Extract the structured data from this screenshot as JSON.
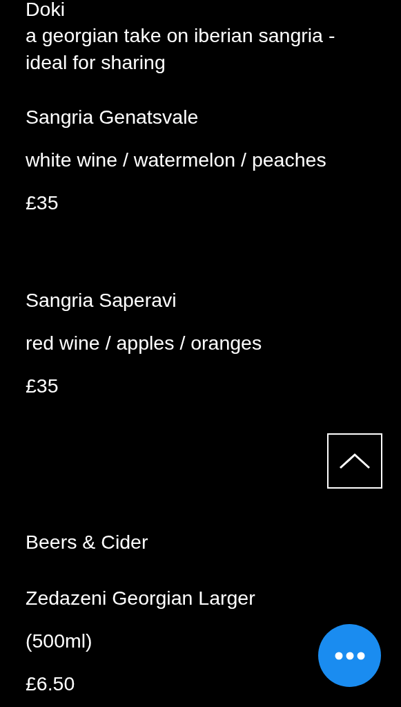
{
  "sections": [
    {
      "title": "Doki",
      "description": "a georgian take on iberian sangria - ideal for sharing",
      "items": [
        {
          "name": "Sangria Genatsvale",
          "description": "white wine / watermelon / peaches",
          "price": "£35"
        },
        {
          "name": "Sangria Saperavi",
          "description": "red wine / apples / oranges",
          "price": "£35"
        }
      ]
    },
    {
      "title": "Beers & Cider",
      "items": [
        {
          "name": "Zedazeni Georgian Larger",
          "description": "(500ml)",
          "price": "£6.50"
        }
      ]
    }
  ]
}
